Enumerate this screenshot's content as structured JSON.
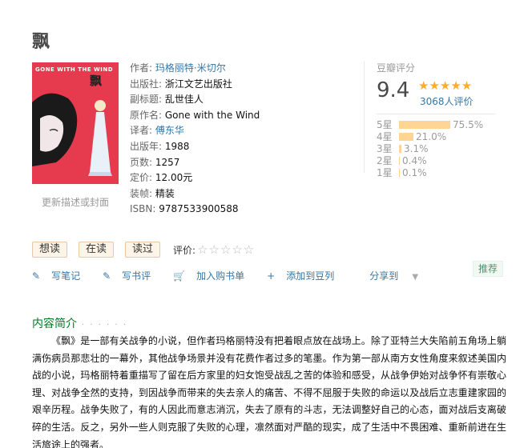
{
  "book": {
    "title": "飘",
    "cover_header": "GONE WITH THE WIND",
    "cover_big": "飘",
    "update_cover_link": "更新描述或封面",
    "info": {
      "author_label": "作者:",
      "author": "玛格丽特·米切尔",
      "publisher_label": "出版社:",
      "publisher": "浙江文艺出版社",
      "subtitle_label": "副标题:",
      "subtitle": "乱世佳人",
      "original_label": "原作名:",
      "original": "Gone with the Wind",
      "translator_label": "译者:",
      "translator": "傅东华",
      "year_label": "出版年:",
      "year": "1988",
      "pages_label": "页数:",
      "pages": "1257",
      "price_label": "定价:",
      "price": "12.00元",
      "binding_label": "装帧:",
      "binding": "精装",
      "isbn_label": "ISBN:",
      "isbn": "9787533900588"
    }
  },
  "rating": {
    "label": "豆瓣评分",
    "score": "9.4",
    "stars": "★★★★★",
    "people": "3068人评价",
    "bars": [
      {
        "label": "5星",
        "pct_text": "75.5%",
        "pct": 75.5
      },
      {
        "label": "4星",
        "pct_text": "21.0%",
        "pct": 21.0
      },
      {
        "label": "3星",
        "pct_text": "3.1%",
        "pct": 3.1
      },
      {
        "label": "2星",
        "pct_text": "0.4%",
        "pct": 0.4
      },
      {
        "label": "1星",
        "pct_text": "0.1%",
        "pct": 0.1
      }
    ]
  },
  "buttons": {
    "want": "想读",
    "reading": "在读",
    "read": "读过",
    "rate_label": "评价:",
    "empty_stars": "☆☆☆☆☆"
  },
  "actions": {
    "note": "写笔记",
    "review": "写书评",
    "cart": "加入购书单",
    "doulist": "添加到豆列",
    "share": "分享到",
    "recommend": "推荐"
  },
  "intro": {
    "title": "内容简介",
    "dots": "· · · · · ·",
    "text": "《飘》是一部有关战争的小说，但作者玛格丽特没有把着眼点放在战场上。除了亚特兰大失陷前五角场上躺满伤病员那悲壮的一幕外，其他战争场景并没有花费作者过多的笔墨。作为第一部从南方女性角度来叙述美国内战的小说，玛格丽特着重描写了留在后方家里的妇女饱受战乱之苦的体验和感受，从战争伊始对战争怀有崇敬心理、对战争全然的支持，到因战争而带来的失去亲人的痛苦、不得不屈服于失败的命运以及战后立志重建家园的艰辛历程。战争失败了，有的人因此而意志消沉，失去了原有的斗志，无法调整好自己的心态，面对战后支离破碎的生活。反之，另外一些人则克服了失败的心理，凛然面对严酷的现实，成了生活中不畏困难、重新前进在生活旅途上的强者。"
  }
}
